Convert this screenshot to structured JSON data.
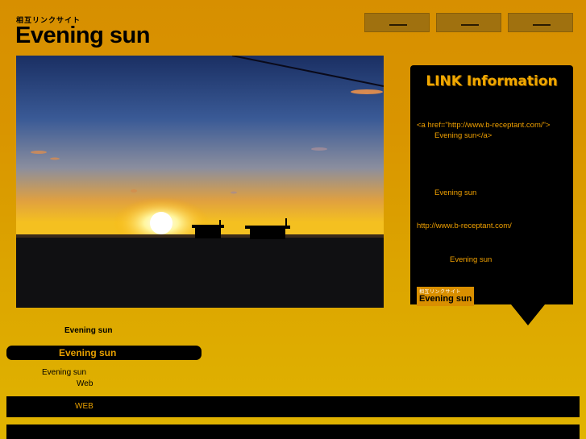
{
  "header": {
    "tagline": "相互リンクサイト",
    "title": "Evening sun",
    "nav": [
      "",
      "",
      ""
    ]
  },
  "photo": {
    "subject": "sunset over the sea"
  },
  "panel": {
    "title": "LINK Information",
    "code_line1": "<a href=\"http://www.b-receptant.com/\">",
    "code_line2": "Evening sun</a>",
    "site_name": "Evening sun",
    "url": "http://www.b-receptant.com/",
    "banner_label": "Evening sun",
    "banner": {
      "tagline": "相互リンクサイト",
      "name": "Evening sun"
    }
  },
  "sidebar": {
    "heading": "Evening sun",
    "pill_label": "Evening sun",
    "text1": "Evening sun",
    "text2": "Web"
  },
  "footer": {
    "bar_label": "WEB"
  },
  "colors": {
    "background": "#d99500",
    "accent": "#f0a800",
    "panel": "#000000"
  }
}
